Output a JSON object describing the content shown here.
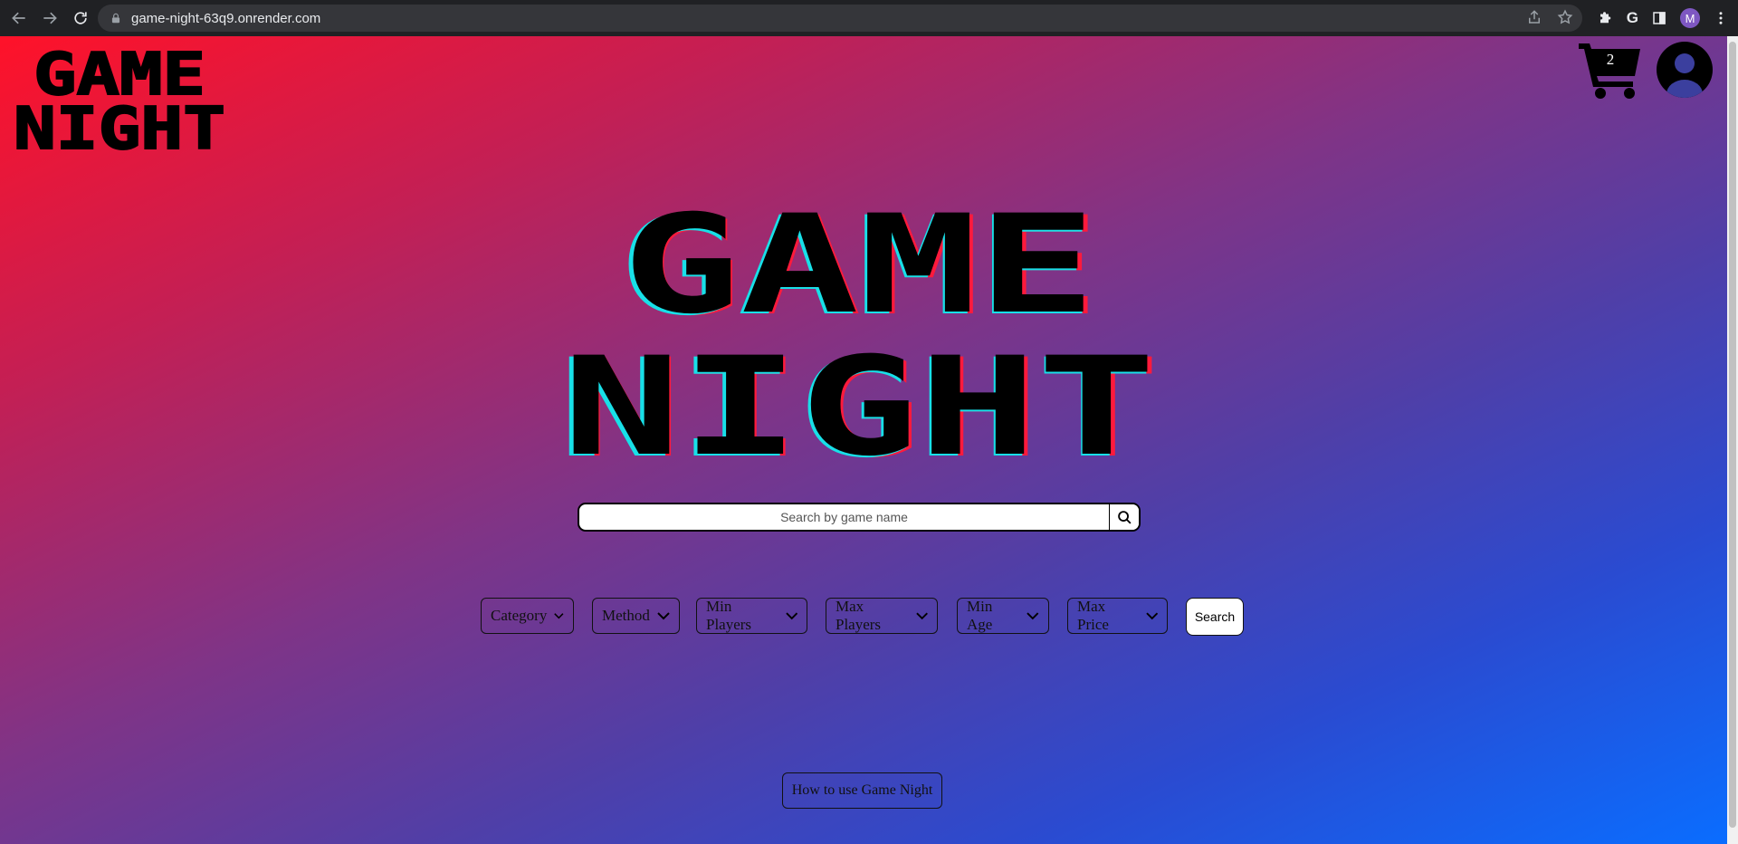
{
  "browser": {
    "url": "game-night-63q9.onrender.com",
    "profile_initial": "M"
  },
  "header": {
    "logo_line1": "GAME",
    "logo_line2": "NIGHT",
    "cart_count": "2"
  },
  "hero": {
    "line1": "GAME",
    "line2": "NIGHT"
  },
  "search": {
    "placeholder": "Search by game name"
  },
  "filters": [
    {
      "label": "Category"
    },
    {
      "label": "Method"
    },
    {
      "label": "Min Players"
    },
    {
      "label": "Max Players"
    },
    {
      "label": "Min Age"
    },
    {
      "label": "Max Price"
    }
  ],
  "search_button_label": "Search",
  "howto_label": "How to use Game Night",
  "colors": {
    "gradient_start": "#ff1229",
    "gradient_mid": "#7f3487",
    "gradient_end": "#0a6dff",
    "title_fill": "#000000",
    "title_shadow_red": "#ff1a3c",
    "title_shadow_cyan": "#18e0e8"
  }
}
